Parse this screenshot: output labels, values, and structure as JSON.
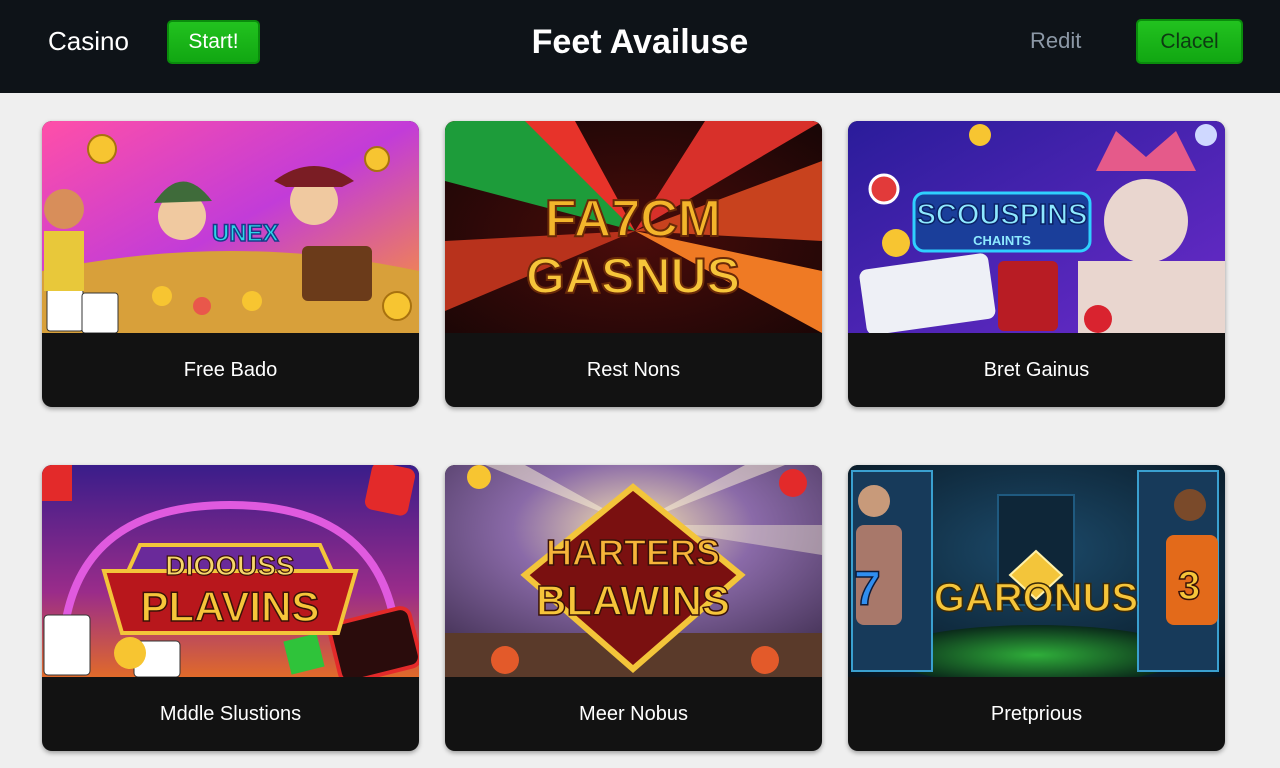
{
  "header": {
    "brand": "Casino",
    "start_label": "Start!",
    "title": "Feet Availuse",
    "redit_label": "Redit",
    "cancel_label": "Clacel"
  },
  "colors": {
    "topbar": "#0e1318",
    "accent_green": "#1cb81a",
    "page_bg": "#efefef",
    "card_footer": "#121212"
  },
  "games": [
    {
      "label": "Free Bado",
      "art_text": [
        "UNEX"
      ]
    },
    {
      "label": "Rest Nons",
      "art_text": [
        "FA7CM",
        "GASNUS"
      ]
    },
    {
      "label": "Bret Gainus",
      "art_text": [
        "SCOUSPINS",
        "CHAINTS"
      ]
    },
    {
      "label": "Mddle Slustions",
      "art_text": [
        "DIOOUSS",
        "PLAVINS"
      ]
    },
    {
      "label": "Meer Nobus",
      "art_text": [
        "HARTERS",
        "BLAWINS"
      ]
    },
    {
      "label": "Pretprious",
      "art_text": [
        "GARONUS",
        "7",
        "3"
      ]
    }
  ]
}
